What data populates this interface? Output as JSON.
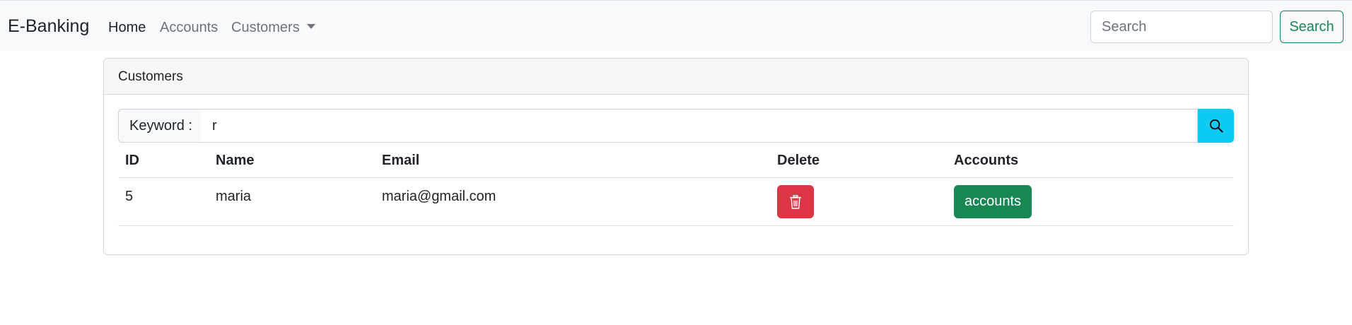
{
  "navbar": {
    "brand": "E-Banking",
    "links": [
      {
        "label": "Home",
        "active": true
      },
      {
        "label": "Accounts",
        "active": false
      },
      {
        "label": "Customers",
        "active": false,
        "dropdown": true
      }
    ],
    "search_placeholder": "Search",
    "search_button": "Search"
  },
  "card": {
    "header": "Customers",
    "keyword_label": "Keyword :",
    "keyword_value": "r",
    "search_icon": "search-icon"
  },
  "table": {
    "headers": [
      "ID",
      "Name",
      "Email",
      "Delete",
      "Accounts"
    ],
    "rows": [
      {
        "id": "5",
        "name": "maria",
        "email": "maria@gmail.com",
        "delete_icon": "trash-icon",
        "accounts_label": "accounts"
      }
    ]
  },
  "colors": {
    "navbar_bg": "#f8f9fa",
    "success": "#198754",
    "danger": "#dc3545",
    "info": "#0dcaf0"
  }
}
